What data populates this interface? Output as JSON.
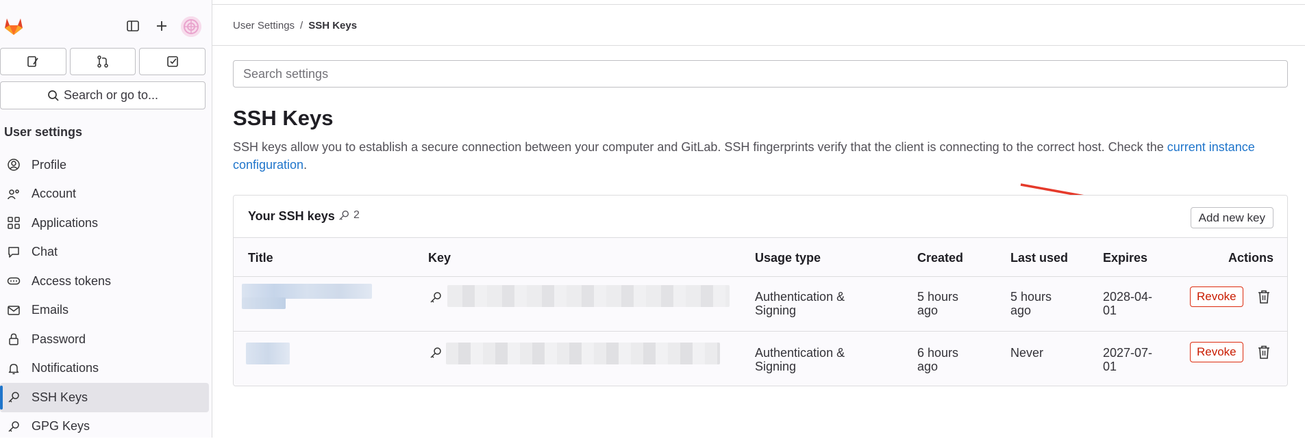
{
  "sidebar": {
    "icons": {
      "logo": "gitlab-logo",
      "toggle": "sidebar-toggle-icon",
      "new": "plus-icon",
      "avatar": "user-avatar"
    },
    "row_buttons": [
      "issues-icon",
      "merge-request-icon",
      "todo-icon"
    ],
    "search_label": "Search or go to...",
    "heading": "User settings",
    "items": [
      {
        "label": "Profile",
        "icon": "profile-icon"
      },
      {
        "label": "Account",
        "icon": "account-icon"
      },
      {
        "label": "Applications",
        "icon": "applications-icon"
      },
      {
        "label": "Chat",
        "icon": "chat-icon"
      },
      {
        "label": "Access tokens",
        "icon": "token-icon"
      },
      {
        "label": "Emails",
        "icon": "email-icon"
      },
      {
        "label": "Password",
        "icon": "lock-icon"
      },
      {
        "label": "Notifications",
        "icon": "bell-icon"
      },
      {
        "label": "SSH Keys",
        "icon": "key-icon",
        "active": true
      },
      {
        "label": "GPG Keys",
        "icon": "key-icon"
      }
    ]
  },
  "breadcrumb": {
    "parent": "User Settings",
    "separator": "/",
    "current": "SSH Keys"
  },
  "search": {
    "placeholder": "Search settings"
  },
  "page": {
    "title": "SSH Keys",
    "description": "SSH keys allow you to establish a secure connection between your computer and GitLab. SSH fingerprints verify that the client is connecting to the correct host. Check the ",
    "link_text": "current instance configuration",
    "description_end": "."
  },
  "card": {
    "title": "Your SSH keys",
    "count": "2",
    "add_button": "Add new key",
    "columns": [
      "Title",
      "Key",
      "Usage type",
      "Created",
      "Last used",
      "Expires",
      "Actions"
    ],
    "rows": [
      {
        "usage_line1": "Authentication &",
        "usage_line2": "Signing",
        "created_line1": "5 hours",
        "created_line2": "ago",
        "last_used_line1": "5 hours",
        "last_used_line2": "ago",
        "expires_line1": "2028-04-",
        "expires_line2": "01",
        "revoke": "Revoke"
      },
      {
        "usage_line1": "Authentication &",
        "usage_line2": "Signing",
        "created_line1": "6 hours",
        "created_line2": "ago",
        "last_used_line1": "Never",
        "last_used_line2": "",
        "expires_line1": "2027-07-",
        "expires_line2": "01",
        "revoke": "Revoke"
      }
    ]
  },
  "colors": {
    "accent": "#1f75cb",
    "danger": "#dd2b0e",
    "annotation_arrow": "#e53a2b"
  }
}
